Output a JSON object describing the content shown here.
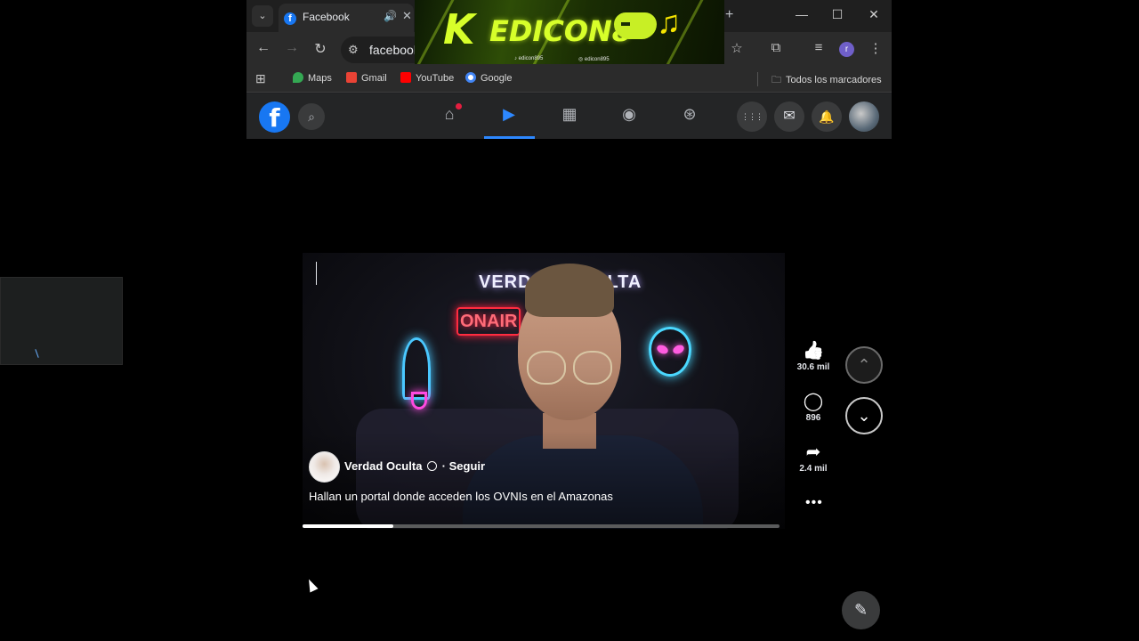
{
  "browser": {
    "tab": {
      "favicon": "f",
      "title": "Facebook",
      "audio_icon": "🔊",
      "close": "✕"
    },
    "tab_menu_icon": "⌄",
    "new_tab": "+",
    "window": {
      "minimize": "—",
      "maximize": "☐",
      "close": "✕"
    },
    "toolbar": {
      "back": "←",
      "forward": "→",
      "reload": "↻",
      "site_info": "⚙",
      "url": "facebook",
      "bookmark_star": "☆",
      "extensions": "⧉",
      "media": "≡",
      "profile_initial": "r",
      "menu": "⋮"
    },
    "bookmarks": {
      "apps_icon": "⊞",
      "items": [
        {
          "label": "Maps",
          "color": "#34a853"
        },
        {
          "label": "Gmail",
          "color": "#ea4335"
        },
        {
          "label": "YouTube",
          "color": "#ff0000"
        },
        {
          "label": "Google",
          "color": "#4285f4"
        }
      ],
      "all_bookmarks": "Todos los marcadores",
      "folder_icon": "🗀"
    }
  },
  "banner": {
    "letter": "K",
    "name": "EDICON8",
    "note": "♫",
    "handle_tiktok": "♪ edicon895",
    "handle_instagram": "◎ edicon895"
  },
  "facebook": {
    "logo": "f",
    "search_icon": "⌕",
    "nav": {
      "home": "⌂",
      "video": "▶",
      "marketplace": "▦",
      "groups": "◉",
      "gaming": "⊛"
    },
    "menu_icon": "⋮⋮⋮",
    "messenger_icon": "✉",
    "notifications_icon": "🔔"
  },
  "video": {
    "neon_sign": "VERDAD OCULTA",
    "on_air": "ONAIR",
    "author_name": "Verdad Oculta",
    "separator": "·",
    "follow": "Seguir",
    "caption": "Hallan un portal donde acceden los OVNIs en el Amazonas",
    "progress": 0.19
  },
  "actions": {
    "like": {
      "icon": "👍",
      "count": "30.6 mil"
    },
    "comment": {
      "icon": "◯",
      "count": "896"
    },
    "share": {
      "icon": "➦",
      "count": "2.4 mil"
    },
    "more": "•••",
    "prev_icon": "⌃",
    "next_icon": "⌄",
    "compose_icon": "✎"
  }
}
